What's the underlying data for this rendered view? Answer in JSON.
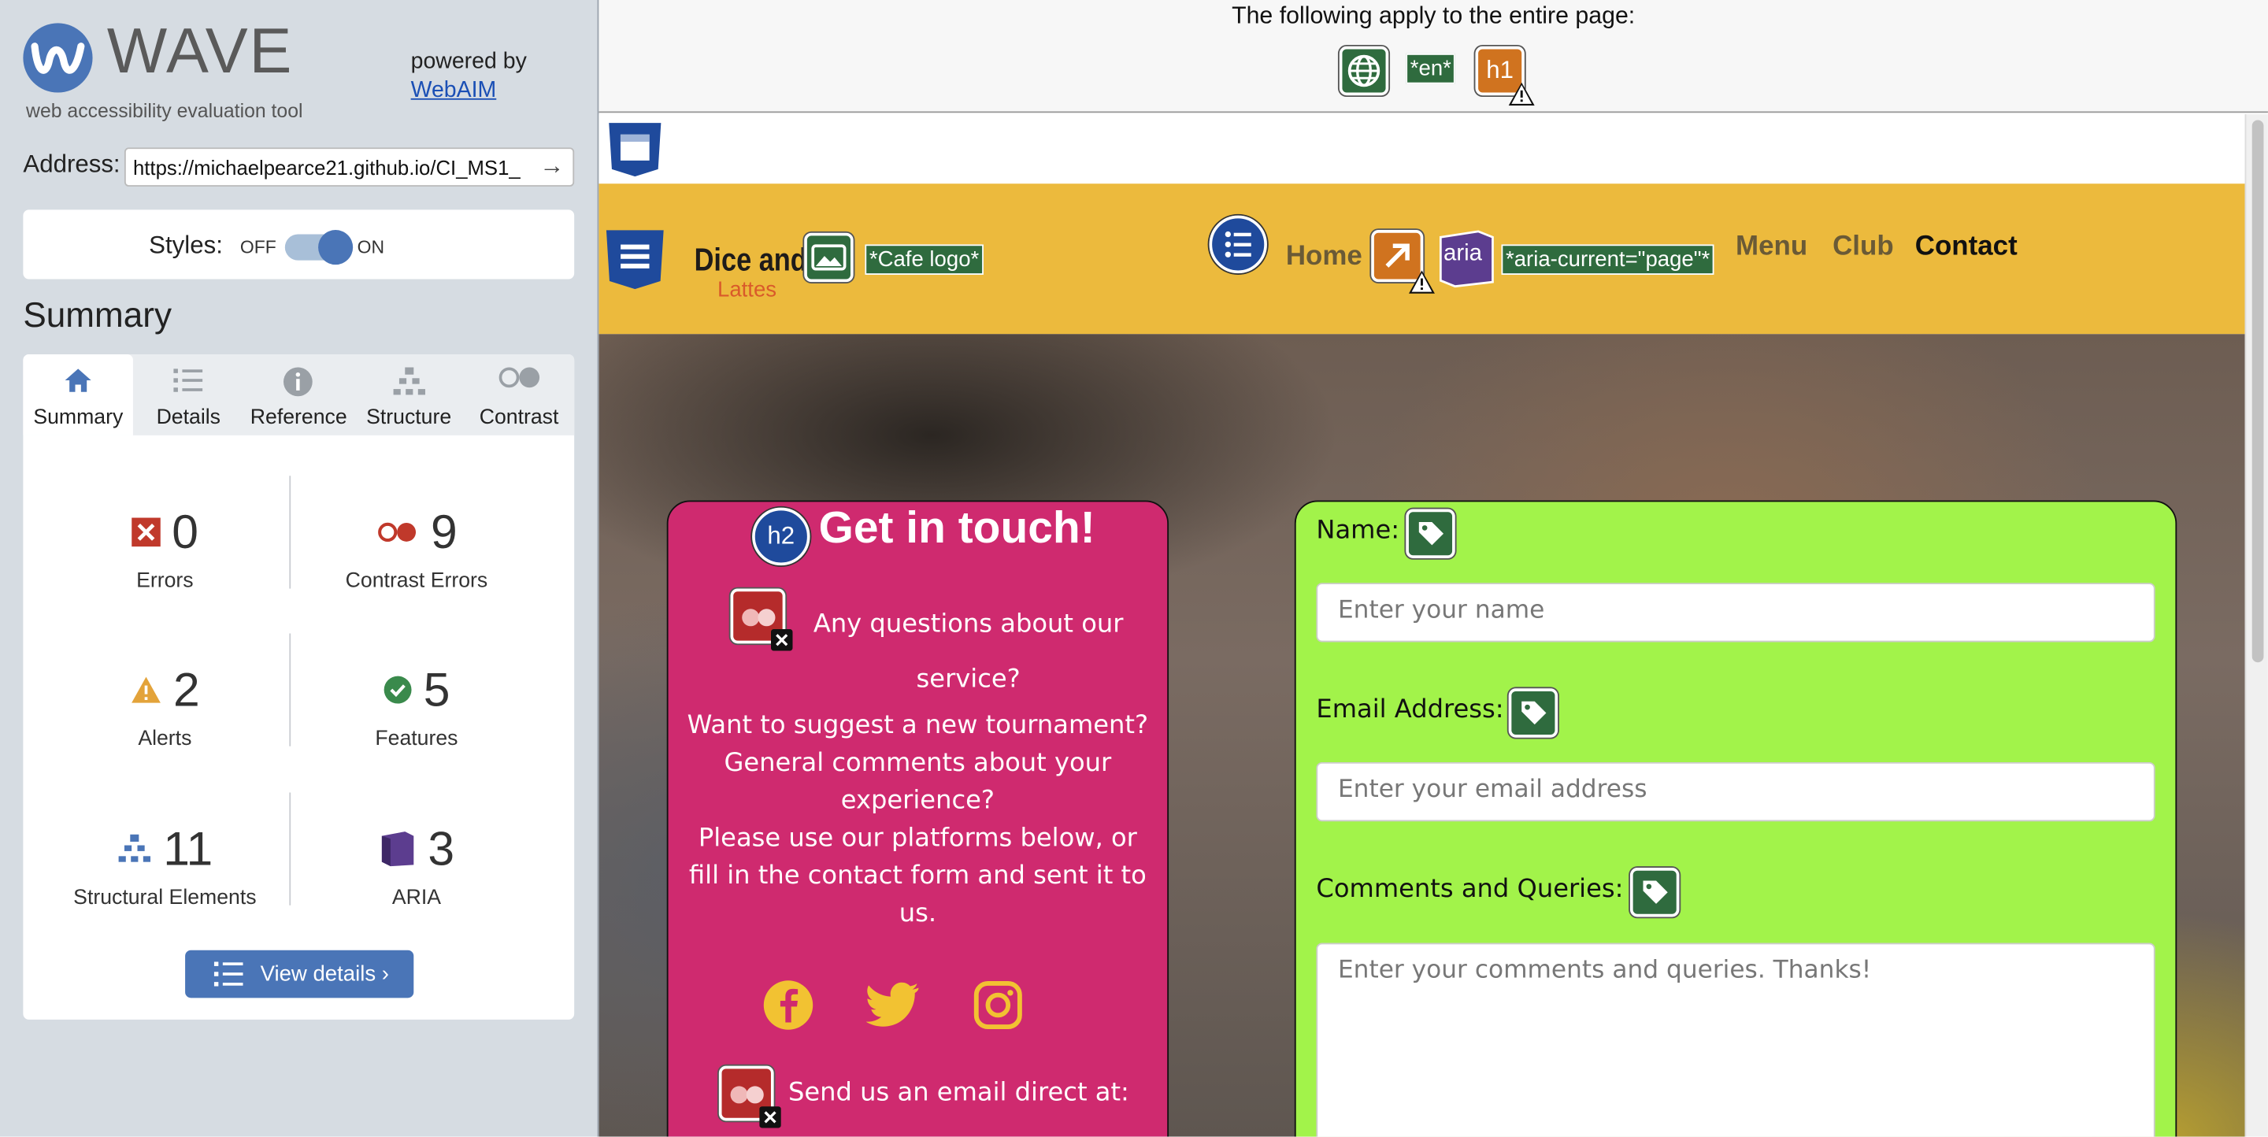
{
  "wave": {
    "logo_text": "WAVE",
    "logo_subtitle": "web accessibility evaluation tool",
    "powered_by": "powered by",
    "powered_link": "WebAIM",
    "address_label": "Address:",
    "address_value": "https://michaelpearce21.github.io/CI_MS1_",
    "styles_label": "Styles:",
    "styles_off": "OFF",
    "styles_on": "ON",
    "styles_enabled": true,
    "summary_heading": "Summary",
    "tabs": [
      {
        "label": "Summary",
        "icon": "home-icon",
        "active": true
      },
      {
        "label": "Details",
        "icon": "list-icon",
        "active": false
      },
      {
        "label": "Reference",
        "icon": "info-icon",
        "active": false
      },
      {
        "label": "Structure",
        "icon": "hierarchy-icon",
        "active": false
      },
      {
        "label": "Contrast",
        "icon": "contrast-icon",
        "active": false
      }
    ],
    "stats": {
      "errors": {
        "count": "0",
        "label": "Errors",
        "color": "#c0392b"
      },
      "contrast": {
        "count": "9",
        "label": "Contrast Errors",
        "color": "#c0392b"
      },
      "alerts": {
        "count": "2",
        "label": "Alerts",
        "color": "#e3a33a"
      },
      "features": {
        "count": "5",
        "label": "Features",
        "color": "#3a8a4c"
      },
      "structural": {
        "count": "11",
        "label": "Structural Elements",
        "color": "#4a75b7"
      },
      "aria": {
        "count": "3",
        "label": "ARIA",
        "color": "#5c3d8f"
      }
    },
    "view_details": "View details ›"
  },
  "page_banner": {
    "text": "The following apply to the entire page:",
    "lang_label": "*en*",
    "h1_label": "h1"
  },
  "site": {
    "brand_line1": "Dice and",
    "brand_line2": "Lattes",
    "logo_alt_label": "*Cafe logo*",
    "nav": {
      "home": "Home",
      "aria_label": "aria",
      "aria_current_label": "*aria-current=\"page\"*",
      "menu": "Menu",
      "club": "Club",
      "contact": "Contact"
    },
    "contact_card": {
      "heading_badge": "h2",
      "title": "Get in touch!",
      "line1": "Any questions about our service?",
      "line2": "Want to suggest a new tournament?",
      "line3": "General comments about your experience?",
      "line4": "Please use our platforms below, or fill in the contact form and sent it to us.",
      "email_line": "Send us an email direct at:",
      "social_color": "#f2c232"
    },
    "form": {
      "name_label": "Name:",
      "name_placeholder": "Enter your name",
      "email_label": "Email Address:",
      "email_placeholder": "Enter your email address",
      "comments_label": "Comments and Queries:",
      "comments_placeholder": "Enter your comments and queries. Thanks!"
    }
  }
}
